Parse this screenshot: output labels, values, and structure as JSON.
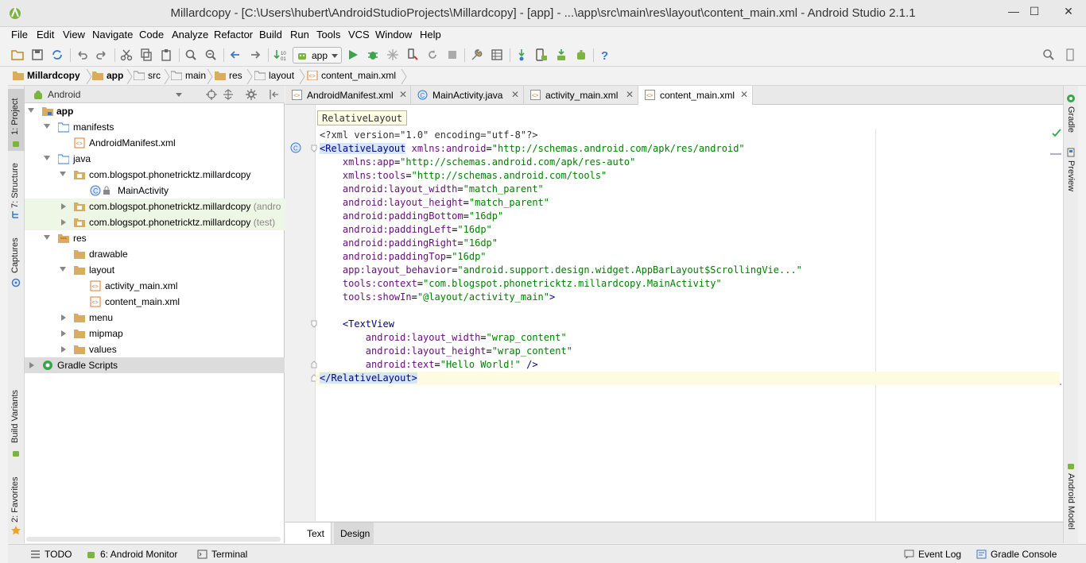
{
  "window": {
    "title": "Millardcopy - [C:\\Users\\hubert\\AndroidStudioProjects\\Millardcopy] - [app] - ...\\app\\src\\main\\res\\layout\\content_main.xml - Android Studio 2.1.1",
    "min": "—",
    "max": "☐",
    "close": "✕"
  },
  "menu": [
    "File",
    "Edit",
    "View",
    "Navigate",
    "Code",
    "Analyze",
    "Refactor",
    "Build",
    "Run",
    "Tools",
    "VCS",
    "Window",
    "Help"
  ],
  "toolbar": {
    "run_config": "app",
    "icons": [
      "open-folder-icon",
      "save-icon",
      "sync-icon",
      "undo-icon",
      "redo-icon",
      "cut-icon",
      "copy-icon",
      "paste-icon",
      "find-icon",
      "replace-icon",
      "back-icon",
      "forward-icon",
      "make-project-icon",
      "run-icon",
      "debug-icon",
      "attach-debugger-icon",
      "apply-changes-icon",
      "rerun-icon",
      "stop-icon",
      "project-structure-icon",
      "sdk-manager-icon",
      "avd-manager-icon",
      "sync-gradle-icon",
      "android-device-monitor-icon",
      "help-icon",
      "search-everywhere-icon",
      "hide-toolbar-icon"
    ]
  },
  "breadcrumbs": [
    "Millardcopy",
    "app",
    "src",
    "main",
    "res",
    "layout",
    "content_main.xml"
  ],
  "left_tabs": [
    "1: Project",
    "7: Structure",
    "Captures",
    "Build Variants",
    "2: Favorites"
  ],
  "right_tabs": [
    "Gradle",
    "Preview",
    "Android Model"
  ],
  "project": {
    "view": "Android",
    "tree": [
      {
        "label": "app",
        "extra": ""
      },
      {
        "label": "manifests",
        "extra": ""
      },
      {
        "label": "AndroidManifest.xml",
        "extra": ""
      },
      {
        "label": "java",
        "extra": ""
      },
      {
        "label": "com.blogspot.phonetricktz.millardcopy",
        "extra": ""
      },
      {
        "label": "MainActivity",
        "extra": ""
      },
      {
        "label": "com.blogspot.phonetricktz.millardcopy",
        "extra": "(andro"
      },
      {
        "label": "com.blogspot.phonetricktz.millardcopy",
        "extra": "(test)"
      },
      {
        "label": "res",
        "extra": ""
      },
      {
        "label": "drawable",
        "extra": ""
      },
      {
        "label": "layout",
        "extra": ""
      },
      {
        "label": "activity_main.xml",
        "extra": ""
      },
      {
        "label": "content_main.xml",
        "extra": ""
      },
      {
        "label": "menu",
        "extra": ""
      },
      {
        "label": "mipmap",
        "extra": ""
      },
      {
        "label": "values",
        "extra": ""
      },
      {
        "label": "Gradle Scripts",
        "extra": ""
      }
    ]
  },
  "editor_tabs": [
    {
      "label": "AndroidManifest.xml",
      "close": "✕"
    },
    {
      "label": "MainActivity.java",
      "close": "✕"
    },
    {
      "label": "activity_main.xml",
      "close": "✕"
    },
    {
      "label": "content_main.xml",
      "close": "✕"
    }
  ],
  "editor": {
    "crumb_tip": "RelativeLayout",
    "gutter_marker": "C",
    "code": [
      "<?xml version=\"1.0\" encoding=\"utf-8\"?>",
      "<RelativeLayout xmlns:android=\"http://schemas.android.com/apk/res/android\"",
      "    xmlns:app=\"http://schemas.android.com/apk/res-auto\"",
      "    xmlns:tools=\"http://schemas.android.com/tools\"",
      "    android:layout_width=\"match_parent\"",
      "    android:layout_height=\"match_parent\"",
      "    android:paddingBottom=\"16dp\"",
      "    android:paddingLeft=\"16dp\"",
      "    android:paddingRight=\"16dp\"",
      "    android:paddingTop=\"16dp\"",
      "    app:layout_behavior=\"android.support.design.widget.AppBarLayout$ScrollingVie...\"",
      "    tools:context=\"com.blogspot.phonetricktz.millardcopy.MainActivity\"",
      "    tools:showIn=\"@layout/activity_main\">",
      "",
      "    <TextView",
      "        android:layout_width=\"wrap_content\"",
      "        android:layout_height=\"wrap_content\"",
      "        android:text=\"Hello World!\" />",
      "</RelativeLayout>"
    ],
    "bottom_tabs": [
      "Text",
      "Design"
    ]
  },
  "statusbar": {
    "left": [
      "TODO",
      "6: Android Monitor",
      "Terminal"
    ],
    "right": [
      "Event Log",
      "Gradle Console"
    ]
  },
  "colors": {
    "android_green": "#7cb342",
    "run_green": "#3aa54a",
    "xml_tag": "#000080",
    "xml_attr": "#660e7a",
    "xml_value": "#008000"
  }
}
